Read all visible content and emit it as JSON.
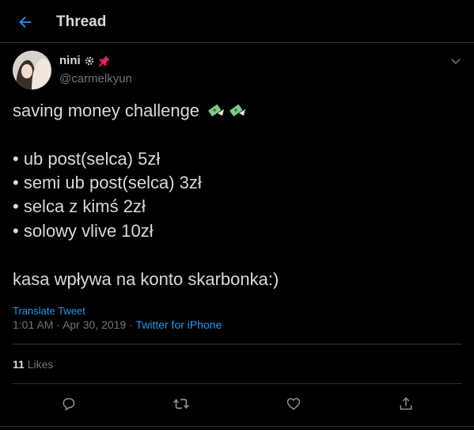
{
  "header": {
    "title": "Thread"
  },
  "author": {
    "name": "nini",
    "handle": "@carmelkyun"
  },
  "tweet": {
    "lines": [
      "saving money challenge",
      "• ub post(selca) 5zł",
      "• semi ub post(selca) 3zł",
      "• selca z kimś 2zł",
      "• solowy vlive 10zł",
      "kasa wpływa na konto skarbonka:)"
    ],
    "translate": "Translate Tweet",
    "time": "1:01 AM",
    "separator1": "·",
    "date": "Apr 30, 2019",
    "separator2": "·",
    "source": "Twitter for iPhone"
  },
  "stats": {
    "likes_count": "11",
    "likes_label": "Likes"
  },
  "colors": {
    "accent": "#1d9bf0",
    "background": "#000000",
    "text": "#d9d9d9",
    "muted": "#6e767d"
  }
}
